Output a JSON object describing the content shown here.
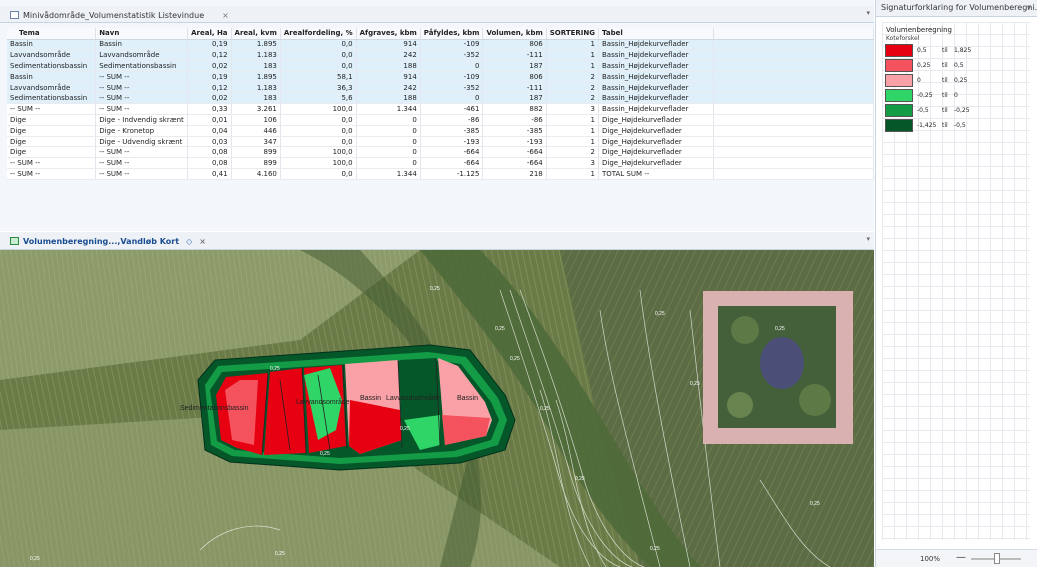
{
  "table_window": {
    "title": "Minivådområde_Volumenstatistik Listevindue",
    "close_glyph": "×",
    "columns": [
      "Tema",
      "Navn",
      "Areal, Ha",
      "Areal, kvm",
      "Arealfordeling, %",
      "Afgraves, kbm",
      "Påfyldes, kbm",
      "Volumen, kbm",
      "SORTERING",
      "Tabel"
    ],
    "rows": [
      [
        "Bassin",
        "Bassin",
        "0,19",
        "1.895",
        "0,0",
        "914",
        "-109",
        "806",
        "1",
        "Bassin_Højdekurveflader"
      ],
      [
        "Lavvandsområde",
        "Lavvandsområde",
        "0,12",
        "1.183",
        "0,0",
        "242",
        "-352",
        "-111",
        "1",
        "Bassin_Højdekurveflader"
      ],
      [
        "Sedimentationsbassin",
        "Sedimentationsbassin",
        "0,02",
        "183",
        "0,0",
        "188",
        "0",
        "187",
        "1",
        "Bassin_Højdekurveflader"
      ],
      [
        "Bassin",
        "-- SUM --",
        "0,19",
        "1.895",
        "58,1",
        "914",
        "-109",
        "806",
        "2",
        "Bassin_Højdekurveflader"
      ],
      [
        "Lavvandsområde",
        "-- SUM --",
        "0,12",
        "1.183",
        "36,3",
        "242",
        "-352",
        "-111",
        "2",
        "Bassin_Højdekurveflader"
      ],
      [
        "Sedimentationsbassin",
        "-- SUM --",
        "0,02",
        "183",
        "5,6",
        "188",
        "0",
        "187",
        "2",
        "Bassin_Højdekurveflader"
      ],
      [
        "-- SUM --",
        "-- SUM --",
        "0,33",
        "3.261",
        "100,0",
        "1.344",
        "-461",
        "882",
        "3",
        "Bassin_Højdekurveflader"
      ],
      [
        "Dige",
        "Dige - Indvendig skrænt",
        "0,01",
        "106",
        "0,0",
        "0",
        "-86",
        "-86",
        "1",
        "Dige_Højdekurveflader"
      ],
      [
        "Dige",
        "Dige - Kronetop",
        "0,04",
        "446",
        "0,0",
        "0",
        "-385",
        "-385",
        "1",
        "Dige_Højdekurveflader"
      ],
      [
        "Dige",
        "Dige - Udvendig skrænt",
        "0,03",
        "347",
        "0,0",
        "0",
        "-193",
        "-193",
        "1",
        "Dige_Højdekurveflader"
      ],
      [
        "Dige",
        "-- SUM --",
        "0,08",
        "899",
        "100,0",
        "0",
        "-664",
        "-664",
        "2",
        "Dige_Højdekurveflader"
      ],
      [
        "-- SUM --",
        "-- SUM --",
        "0,08",
        "899",
        "100,0",
        "0",
        "-664",
        "-664",
        "3",
        "Dige_Højdekurveflader"
      ],
      [
        "-- SUM --",
        "-- SUM --",
        "0,41",
        "4.160",
        "0,0",
        "1.344",
        "-1.125",
        "218",
        "1",
        "TOTAL SUM --"
      ]
    ]
  },
  "map_window": {
    "title": "Volumenberegning...,Vandløb Kort",
    "close_glyph": "×",
    "pin_glyph": "◇",
    "labels": [
      "Sedimentationsbassin",
      "Lavvandsområde",
      "Bassin",
      "Lavvandsområde",
      "Bassin"
    ],
    "contour_label": "0,25"
  },
  "legend_window": {
    "title": "Signaturforklaring for Volumenberegni...",
    "caret": "▾",
    "group_title": "Volumenberegning",
    "group_subtitle": "Koteforskel",
    "til_word": "til",
    "classes": [
      {
        "from": "0,5",
        "to": "1,825",
        "color": "#e60012"
      },
      {
        "from": "0,25",
        "to": "0,5",
        "color": "#f4525d"
      },
      {
        "from": "0",
        "to": "0,25",
        "color": "#f9a1a6"
      },
      {
        "from": "-0,25",
        "to": "0",
        "color": "#2fd667"
      },
      {
        "from": "-0,5",
        "to": "-0,25",
        "color": "#139b45"
      },
      {
        "from": "-1,425",
        "to": "-0,5",
        "color": "#05572a"
      }
    ],
    "zoom": "100%",
    "zoom_minus": "—"
  },
  "colors": {
    "selected_row": "#dff0fb",
    "panel_bg": "#eef2f7"
  }
}
